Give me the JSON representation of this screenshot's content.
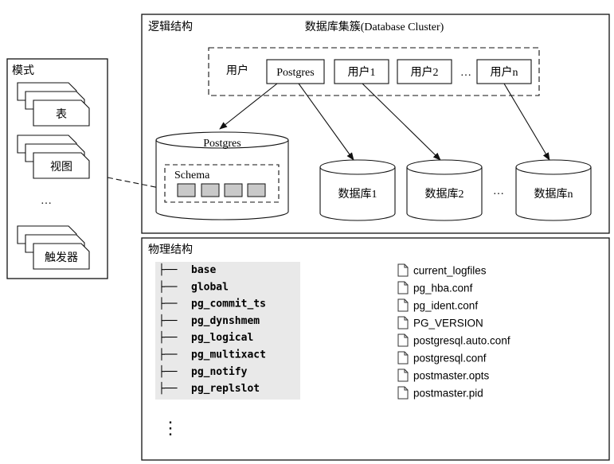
{
  "mode_panel": {
    "title": "模式",
    "items": [
      "表",
      "视图",
      "触发器"
    ],
    "ellipsis": "…"
  },
  "logical": {
    "title": "逻辑结构",
    "cluster_title": "数据库集簇(Database Cluster)",
    "users_label": "用户",
    "users": [
      "Postgres",
      "用户1",
      "用户2",
      "用户n"
    ],
    "users_ellipsis": "…",
    "main_db": "Postgres",
    "schema_label": "Schema",
    "databases": [
      "数据库1",
      "数据库2",
      "数据库n"
    ],
    "db_ellipsis": "…"
  },
  "physical": {
    "title": "物理结构",
    "dirs": [
      "base",
      "global",
      "pg_commit_ts",
      "pg_dynshmem",
      "pg_logical",
      "pg_multixact",
      "pg_notify",
      "pg_replslot"
    ],
    "dir_prefix": "├──",
    "vertical_ellipsis": "⋮",
    "files": [
      "current_logfiles",
      "pg_hba.conf",
      "pg_ident.conf",
      "PG_VERSION",
      "postgresql.auto.conf",
      "postgresql.conf",
      "postmaster.opts",
      "postmaster.pid"
    ]
  }
}
